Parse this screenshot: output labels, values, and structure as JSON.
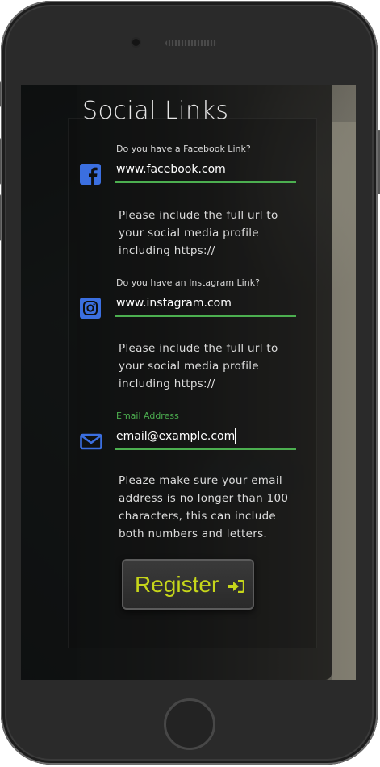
{
  "page": {
    "title": "Social Links"
  },
  "fields": [
    {
      "label": "Do you have a Facebook Link?",
      "value": "www.facebook.com",
      "icon": "facebook-icon",
      "help": "Please include the full url to your social media profile including https://"
    },
    {
      "label": "Do you have an Instagram Link?",
      "value": "www.instagram.com",
      "icon": "instagram-icon",
      "help": "Please include the full url to your social media profile including https://"
    },
    {
      "label": "Email Address",
      "value": "email@example.com",
      "icon": "envelope-icon",
      "help": "Pleaze make sure your email address is no longer than 100 characters, this can include both numbers and letters."
    }
  ],
  "register": {
    "label": "Register",
    "icon": "sign-in-icon"
  },
  "colors": {
    "accent": "#4caf50",
    "icon": "#3b6fe0",
    "button_text": "#c6d61a"
  }
}
